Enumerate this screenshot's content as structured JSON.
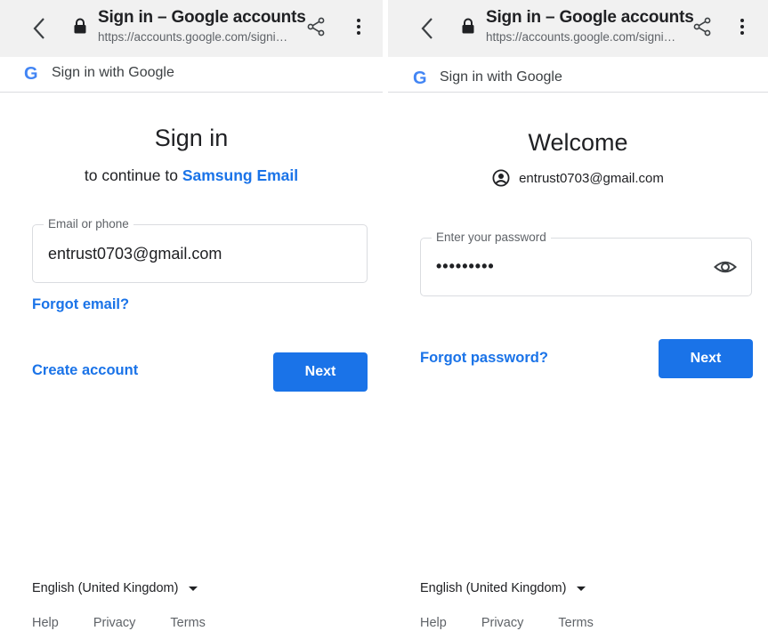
{
  "colors": {
    "accent": "#1a73e8",
    "topbar_bg": "#f1f1f1",
    "border": "#dadce0"
  },
  "icons": {
    "back": "chevron-left-icon",
    "lock": "lock-icon",
    "share": "share-icon",
    "menu": "more-vert-icon",
    "google": "google-g-icon",
    "account": "account-circle-icon",
    "eye": "eye-icon",
    "caret": "caret-down-icon"
  },
  "screens": [
    {
      "topbar": {
        "title": "Sign in – Google accounts",
        "url": "https://accounts.google.com/signi…"
      },
      "subbar": {
        "logo": "G",
        "text": "Sign in with Google"
      },
      "heading": "Sign in",
      "subheading": {
        "prefix": "to continue to ",
        "brand": "Samsung Email"
      },
      "field": {
        "label": "Email or phone",
        "value": "entrust0703@gmail.com"
      },
      "forgot_link": "Forgot email?",
      "create_account": "Create account",
      "next": "Next",
      "language": "English (United Kingdom)",
      "footer": {
        "help": "Help",
        "privacy": "Privacy",
        "terms": "Terms"
      }
    },
    {
      "topbar": {
        "title": "Sign in – Google accounts",
        "url": "https://accounts.google.com/signi…"
      },
      "subbar": {
        "logo": "G",
        "text": "Sign in with Google"
      },
      "heading": "Welcome",
      "account_email": "entrust0703@gmail.com",
      "field": {
        "label": "Enter your password",
        "value": "•••••••••"
      },
      "forgot_link": "Forgot password?",
      "next": "Next",
      "language": "English (United Kingdom)",
      "footer": {
        "help": "Help",
        "privacy": "Privacy",
        "terms": "Terms"
      }
    }
  ]
}
